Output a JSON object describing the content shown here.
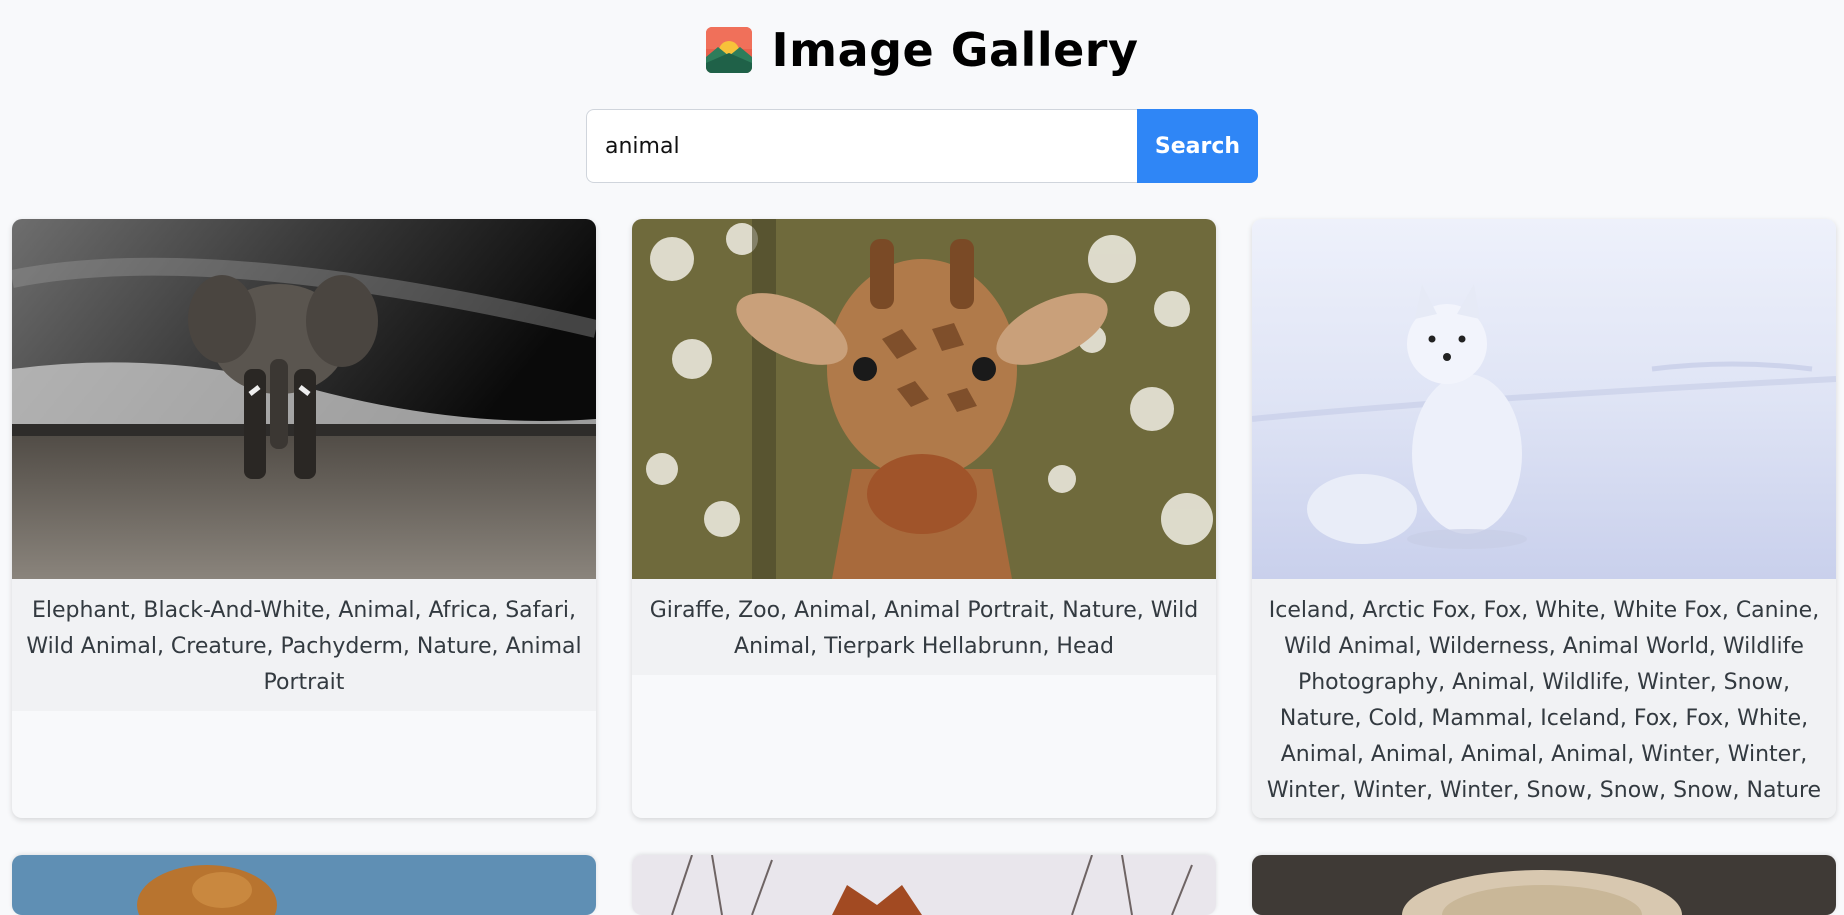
{
  "header": {
    "title": "Image Gallery",
    "logo_icon": "mountain-sunset-icon"
  },
  "search": {
    "value": "animal",
    "button_label": "Search",
    "accent_color": "#2f86f6"
  },
  "cards": [
    {
      "tags": "Elephant, Black-And-White, Animal, Africa, Safari, Wild Animal, Creature, Pachyderm, Nature, Animal Portrait",
      "subject": "elephant"
    },
    {
      "tags": "Giraffe, Zoo, Animal, Animal Portrait, Nature, Wild Animal, Tierpark Hellabrunn, Head",
      "subject": "giraffe"
    },
    {
      "tags": "Iceland, Arctic Fox, Fox, White, White Fox, Canine, Wild Animal, Wilderness, Animal World, Wildlife Photography, Animal, Wildlife, Winter, Snow, Nature, Cold, Mammal, Iceland, Fox, Fox, White, Animal, Animal, Animal, Animal, Winter, Winter, Winter, Winter, Winter, Snow, Snow, Snow, Nature",
      "subject": "arctic-fox"
    },
    {
      "subject": "dog-sky"
    },
    {
      "subject": "fox-branches"
    },
    {
      "subject": "furry-animal"
    }
  ]
}
